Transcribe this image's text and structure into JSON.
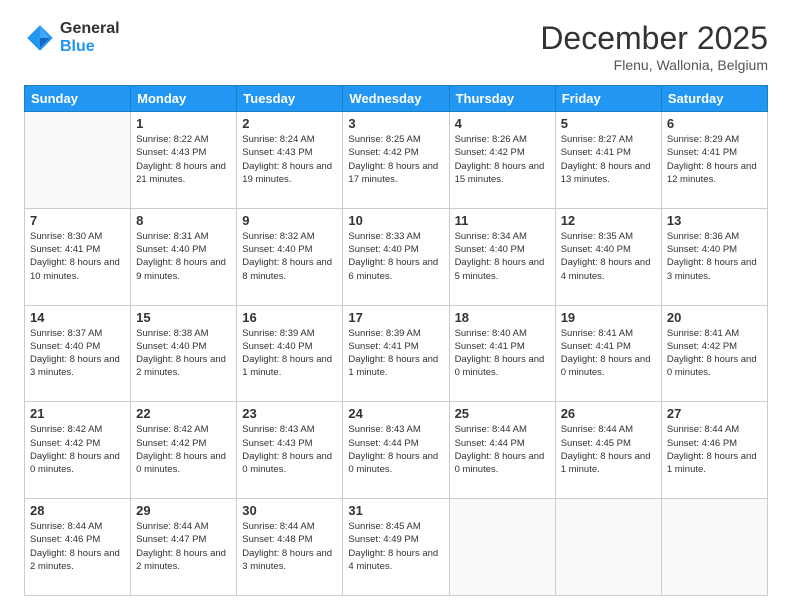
{
  "logo": {
    "general": "General",
    "blue": "Blue"
  },
  "header": {
    "month": "December 2025",
    "location": "Flenu, Wallonia, Belgium"
  },
  "days_of_week": [
    "Sunday",
    "Monday",
    "Tuesday",
    "Wednesday",
    "Thursday",
    "Friday",
    "Saturday"
  ],
  "weeks": [
    [
      {
        "day": null,
        "info": null
      },
      {
        "day": "1",
        "info": "Sunrise: 8:22 AM\nSunset: 4:43 PM\nDaylight: 8 hours\nand 21 minutes."
      },
      {
        "day": "2",
        "info": "Sunrise: 8:24 AM\nSunset: 4:43 PM\nDaylight: 8 hours\nand 19 minutes."
      },
      {
        "day": "3",
        "info": "Sunrise: 8:25 AM\nSunset: 4:42 PM\nDaylight: 8 hours\nand 17 minutes."
      },
      {
        "day": "4",
        "info": "Sunrise: 8:26 AM\nSunset: 4:42 PM\nDaylight: 8 hours\nand 15 minutes."
      },
      {
        "day": "5",
        "info": "Sunrise: 8:27 AM\nSunset: 4:41 PM\nDaylight: 8 hours\nand 13 minutes."
      },
      {
        "day": "6",
        "info": "Sunrise: 8:29 AM\nSunset: 4:41 PM\nDaylight: 8 hours\nand 12 minutes."
      }
    ],
    [
      {
        "day": "7",
        "info": "Sunrise: 8:30 AM\nSunset: 4:41 PM\nDaylight: 8 hours\nand 10 minutes."
      },
      {
        "day": "8",
        "info": "Sunrise: 8:31 AM\nSunset: 4:40 PM\nDaylight: 8 hours\nand 9 minutes."
      },
      {
        "day": "9",
        "info": "Sunrise: 8:32 AM\nSunset: 4:40 PM\nDaylight: 8 hours\nand 8 minutes."
      },
      {
        "day": "10",
        "info": "Sunrise: 8:33 AM\nSunset: 4:40 PM\nDaylight: 8 hours\nand 6 minutes."
      },
      {
        "day": "11",
        "info": "Sunrise: 8:34 AM\nSunset: 4:40 PM\nDaylight: 8 hours\nand 5 minutes."
      },
      {
        "day": "12",
        "info": "Sunrise: 8:35 AM\nSunset: 4:40 PM\nDaylight: 8 hours\nand 4 minutes."
      },
      {
        "day": "13",
        "info": "Sunrise: 8:36 AM\nSunset: 4:40 PM\nDaylight: 8 hours\nand 3 minutes."
      }
    ],
    [
      {
        "day": "14",
        "info": "Sunrise: 8:37 AM\nSunset: 4:40 PM\nDaylight: 8 hours\nand 3 minutes."
      },
      {
        "day": "15",
        "info": "Sunrise: 8:38 AM\nSunset: 4:40 PM\nDaylight: 8 hours\nand 2 minutes."
      },
      {
        "day": "16",
        "info": "Sunrise: 8:39 AM\nSunset: 4:40 PM\nDaylight: 8 hours\nand 1 minute."
      },
      {
        "day": "17",
        "info": "Sunrise: 8:39 AM\nSunset: 4:41 PM\nDaylight: 8 hours\nand 1 minute."
      },
      {
        "day": "18",
        "info": "Sunrise: 8:40 AM\nSunset: 4:41 PM\nDaylight: 8 hours\nand 0 minutes."
      },
      {
        "day": "19",
        "info": "Sunrise: 8:41 AM\nSunset: 4:41 PM\nDaylight: 8 hours\nand 0 minutes."
      },
      {
        "day": "20",
        "info": "Sunrise: 8:41 AM\nSunset: 4:42 PM\nDaylight: 8 hours\nand 0 minutes."
      }
    ],
    [
      {
        "day": "21",
        "info": "Sunrise: 8:42 AM\nSunset: 4:42 PM\nDaylight: 8 hours\nand 0 minutes."
      },
      {
        "day": "22",
        "info": "Sunrise: 8:42 AM\nSunset: 4:42 PM\nDaylight: 8 hours\nand 0 minutes."
      },
      {
        "day": "23",
        "info": "Sunrise: 8:43 AM\nSunset: 4:43 PM\nDaylight: 8 hours\nand 0 minutes."
      },
      {
        "day": "24",
        "info": "Sunrise: 8:43 AM\nSunset: 4:44 PM\nDaylight: 8 hours\nand 0 minutes."
      },
      {
        "day": "25",
        "info": "Sunrise: 8:44 AM\nSunset: 4:44 PM\nDaylight: 8 hours\nand 0 minutes."
      },
      {
        "day": "26",
        "info": "Sunrise: 8:44 AM\nSunset: 4:45 PM\nDaylight: 8 hours\nand 1 minute."
      },
      {
        "day": "27",
        "info": "Sunrise: 8:44 AM\nSunset: 4:46 PM\nDaylight: 8 hours\nand 1 minute."
      }
    ],
    [
      {
        "day": "28",
        "info": "Sunrise: 8:44 AM\nSunset: 4:46 PM\nDaylight: 8 hours\nand 2 minutes."
      },
      {
        "day": "29",
        "info": "Sunrise: 8:44 AM\nSunset: 4:47 PM\nDaylight: 8 hours\nand 2 minutes."
      },
      {
        "day": "30",
        "info": "Sunrise: 8:44 AM\nSunset: 4:48 PM\nDaylight: 8 hours\nand 3 minutes."
      },
      {
        "day": "31",
        "info": "Sunrise: 8:45 AM\nSunset: 4:49 PM\nDaylight: 8 hours\nand 4 minutes."
      },
      {
        "day": null,
        "info": null
      },
      {
        "day": null,
        "info": null
      },
      {
        "day": null,
        "info": null
      }
    ]
  ]
}
